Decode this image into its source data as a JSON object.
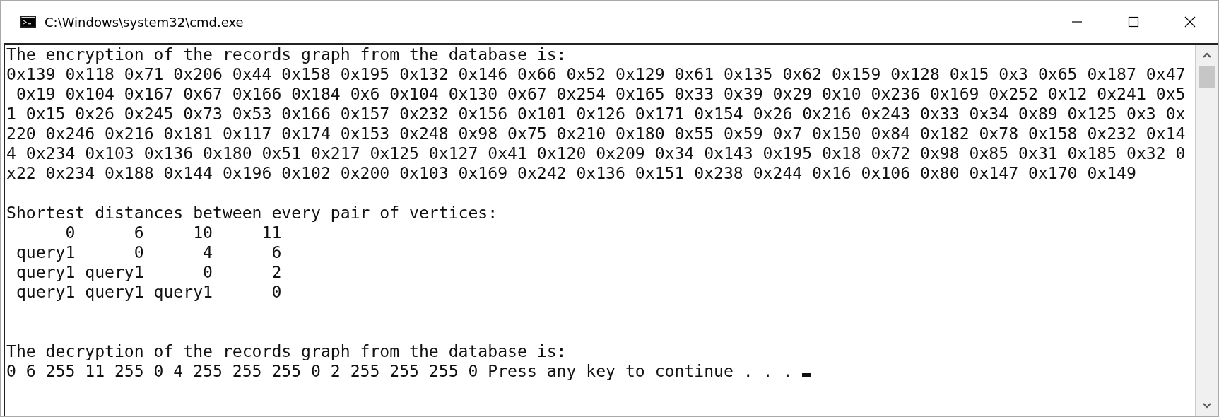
{
  "window": {
    "title": "C:\\Windows\\system32\\cmd.exe"
  },
  "console": {
    "lines": [
      {
        "kind": "text",
        "text": "The encryption of the records graph from the database is:"
      },
      {
        "kind": "text",
        "text": "0x139 0x118 0x71 0x206 0x44 0x158 0x195 0x132 0x146 0x66 0x52 0x129 0x61 0x135 0x62 0x159 0x128 0x15 0x3 0x65 0x187 0x47"
      },
      {
        "kind": "text",
        "text": " 0x19 0x104 0x167 0x67 0x166 0x184 0x6 0x104 0x130 0x67 0x254 0x165 0x33 0x39 0x29 0x10 0x236 0x169 0x252 0x12 0x241 0x5"
      },
      {
        "kind": "text",
        "text": "1 0x15 0x26 0x245 0x73 0x53 0x166 0x157 0x232 0x156 0x101 0x126 0x171 0x154 0x26 0x216 0x243 0x33 0x34 0x89 0x125 0x3 0x"
      },
      {
        "kind": "text",
        "text": "220 0x246 0x216 0x181 0x117 0x174 0x153 0x248 0x98 0x75 0x210 0x180 0x55 0x59 0x7 0x150 0x84 0x182 0x78 0x158 0x232 0x14"
      },
      {
        "kind": "text",
        "text": "4 0x234 0x103 0x136 0x180 0x51 0x217 0x125 0x127 0x41 0x120 0x209 0x34 0x143 0x195 0x18 0x72 0x98 0x85 0x31 0x185 0x32 0"
      },
      {
        "kind": "text",
        "text": "x22 0x234 0x188 0x144 0x196 0x102 0x200 0x103 0x169 0x242 0x136 0x151 0x238 0x244 0x16 0x106 0x80 0x147 0x170 0x149"
      },
      {
        "kind": "blank"
      },
      {
        "kind": "text",
        "text": "Shortest distances between every pair of vertices:"
      },
      {
        "kind": "text",
        "text": "      0      6     10     11"
      },
      {
        "kind": "text",
        "text": " query1      0      4      6"
      },
      {
        "kind": "text",
        "text": " query1 query1      0      2"
      },
      {
        "kind": "text",
        "text": " query1 query1 query1      0"
      },
      {
        "kind": "blank"
      },
      {
        "kind": "blank"
      },
      {
        "kind": "text",
        "text": "The decryption of the records graph from the database is:"
      },
      {
        "kind": "prompt",
        "text": "0 6 255 11 255 0 4 255 255 255 0 2 255 255 255 0 Press any key to continue . . . "
      }
    ]
  }
}
